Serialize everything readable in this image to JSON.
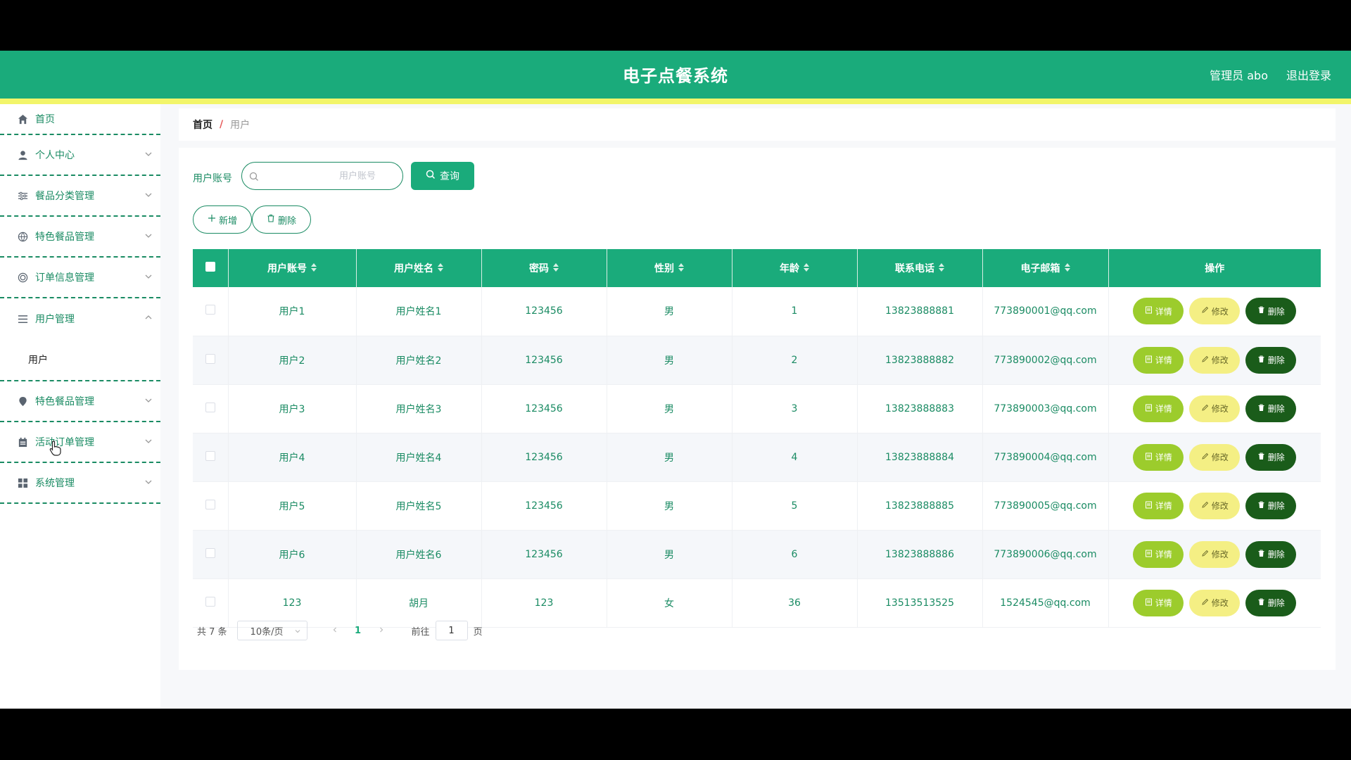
{
  "header": {
    "title": "电子点餐系统",
    "admin_label": "管理员 abo",
    "logout_label": "退出登录"
  },
  "sidebar": {
    "items": [
      {
        "label": "首页",
        "icon": "home-icon"
      },
      {
        "label": "个人中心",
        "icon": "user-icon"
      },
      {
        "label": "餐品分类管理",
        "icon": "sliders-icon"
      },
      {
        "label": "特色餐品管理",
        "icon": "globe-icon"
      },
      {
        "label": "订单信息管理",
        "icon": "target-icon"
      },
      {
        "label": "用户管理",
        "icon": "list-icon"
      },
      {
        "label": "特色餐品管理",
        "icon": "pin-icon"
      },
      {
        "label": "活动订单管理",
        "icon": "calendar-icon"
      },
      {
        "label": "系统管理",
        "icon": "grid-icon"
      }
    ],
    "submenu_user": "用户"
  },
  "breadcrumb": {
    "home": "首页",
    "separator": "/",
    "current": "用户"
  },
  "search": {
    "label": "用户账号",
    "placeholder": "用户账号",
    "query_label": "查询"
  },
  "actions": {
    "add_label": "新增",
    "delete_label": "删除"
  },
  "table": {
    "columns": [
      "用户账号",
      "用户姓名",
      "密码",
      "性别",
      "年龄",
      "联系电话",
      "电子邮箱",
      "操作"
    ],
    "rows": [
      [
        "用户1",
        "用户姓名1",
        "123456",
        "男",
        "1",
        "13823888881",
        "773890001@qq.com"
      ],
      [
        "用户2",
        "用户姓名2",
        "123456",
        "男",
        "2",
        "13823888882",
        "773890002@qq.com"
      ],
      [
        "用户3",
        "用户姓名3",
        "123456",
        "男",
        "3",
        "13823888883",
        "773890003@qq.com"
      ],
      [
        "用户4",
        "用户姓名4",
        "123456",
        "男",
        "4",
        "13823888884",
        "773890004@qq.com"
      ],
      [
        "用户5",
        "用户姓名5",
        "123456",
        "男",
        "5",
        "13823888885",
        "773890005@qq.com"
      ],
      [
        "用户6",
        "用户姓名6",
        "123456",
        "男",
        "6",
        "13823888886",
        "773890006@qq.com"
      ],
      [
        "123",
        "胡月",
        "123",
        "女",
        "36",
        "13513513525",
        "1524545@qq.com"
      ]
    ],
    "op_detail": "详情",
    "op_edit": "修改",
    "op_delete": "删除"
  },
  "pagination": {
    "total": "共 7 条",
    "page_size": "10条/页",
    "current_page": "1",
    "goto_prefix": "前往",
    "goto_value": "1",
    "goto_suffix": "页"
  },
  "colors": {
    "primary": "#1aab7b",
    "accent_bar": "#f2f56a",
    "detail_btn": "#9ccc2c",
    "edit_btn": "#f4ef84",
    "delete_btn": "#1a5c1a"
  }
}
